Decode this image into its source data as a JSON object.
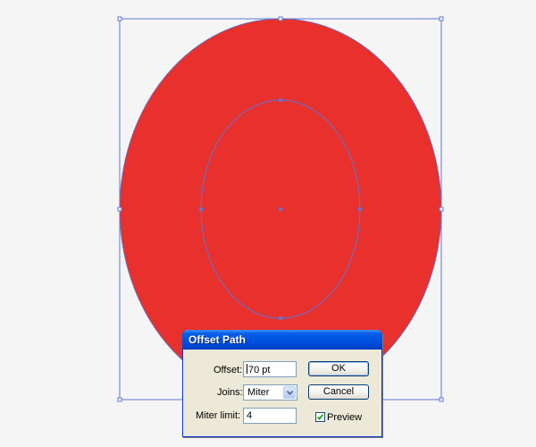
{
  "colors": {
    "canvas_bg": "#f5f5f5",
    "shape_fill": "#e8302d",
    "selection_blue": "#5a76d6",
    "dialog_bg": "#ece9d8",
    "titlebar_blue": "#0054e3"
  },
  "dialog": {
    "title": "Offset Path",
    "offset": {
      "label": "Offset:",
      "value": "70 pt"
    },
    "joins": {
      "label": "Joins:",
      "value": "Miter"
    },
    "miter_limit": {
      "label": "Miter limit:",
      "value": "4"
    },
    "ok_label": "OK",
    "cancel_label": "Cancel",
    "preview": {
      "label": "Preview",
      "checked": true
    }
  }
}
